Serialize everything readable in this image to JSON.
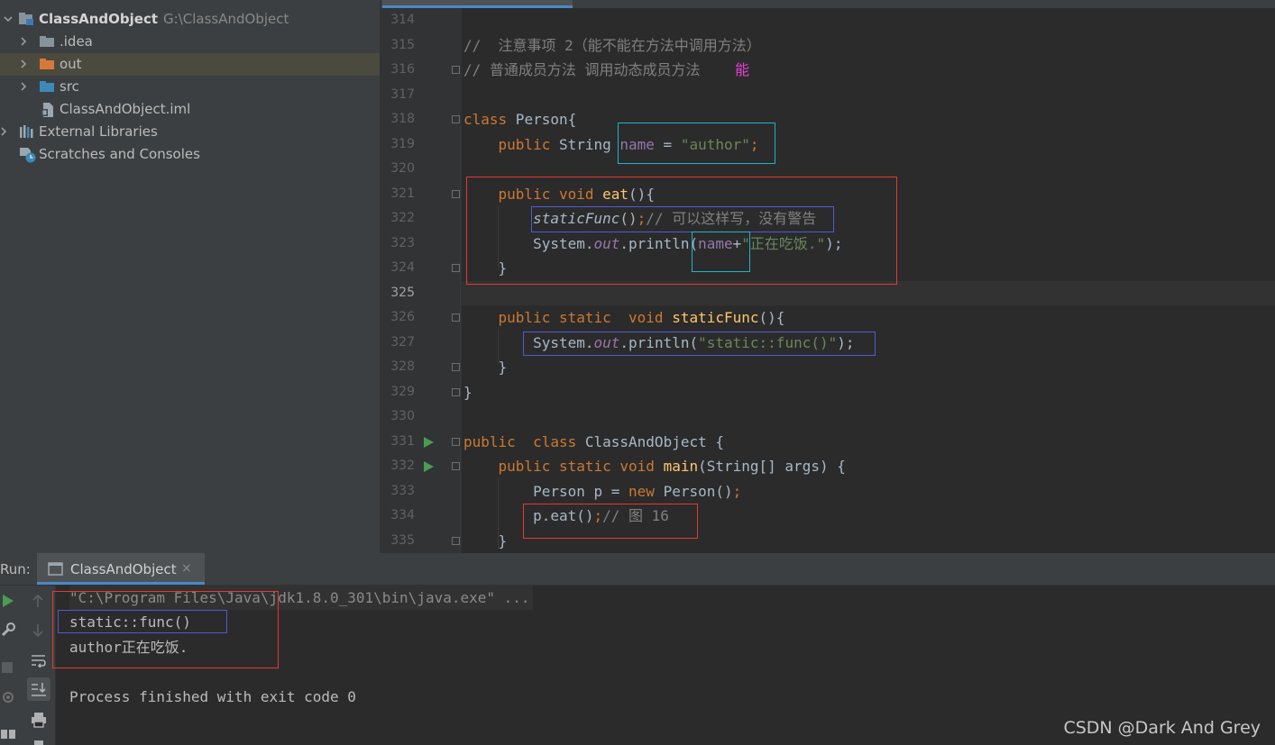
{
  "project": {
    "root_name": "ClassAndObject",
    "root_path": "G:\\ClassAndObject",
    "items": [
      {
        "label": ".idea"
      },
      {
        "label": "out"
      },
      {
        "label": "src"
      },
      {
        "label": "ClassAndObject.iml"
      },
      {
        "label": "External Libraries"
      },
      {
        "label": "Scratches and Consoles"
      }
    ]
  },
  "editor": {
    "line_numbers": [
      "314",
      "315",
      "316",
      "317",
      "318",
      "319",
      "320",
      "321",
      "322",
      "323",
      "324",
      "325",
      "326",
      "327",
      "328",
      "329",
      "330",
      "331",
      "332",
      "333",
      "334",
      "335"
    ],
    "code": {
      "l315": "//  注意事项 2（能不能在方法中调用方法）",
      "l316": "// 普通成员方法 调用动态成员方法",
      "l316_mark": "能",
      "l318_kw": "class",
      "l318_rest": " Person{",
      "l319_kw": "public",
      "l319_type": " String ",
      "l319_field": "name",
      "l319_eq": " = ",
      "l319_str": "\"author\"",
      "l319_semi": ";",
      "l321_kw": "public void",
      "l321_fn": "eat",
      "l321_rest": "(){",
      "l322_call": "staticFunc",
      "l322_paren": "()",
      "l322_semi": ";",
      "l322_cmt": "// 可以这样写，没有警告",
      "l323_sys": "System.",
      "l323_out": "out",
      "l323_println": ".println(",
      "l323_name": "name",
      "l323_plus": "+",
      "l323_str": "\"正在吃饭.\"",
      "l323_end": ");",
      "l324": "}",
      "l326_kw": "public static  void",
      "l326_fn": "staticFunc",
      "l326_rest": "(){",
      "l327_sys": "System.",
      "l327_out": "out",
      "l327_println": ".println(",
      "l327_str": "\"static::func()\"",
      "l327_end": ");",
      "l328": "}",
      "l329": "}",
      "l331_kw": "public  class",
      "l331_rest": " ClassAndObject {",
      "l332_kw": "public static void",
      "l332_fn": "main",
      "l332_rest": "(String[] args) {",
      "l333_a": "Person p = ",
      "l333_kw": "new",
      "l333_b": " Person()",
      "l333_semi": ";",
      "l334_a": "p.eat()",
      "l334_semi": ";",
      "l334_cmt": "// 图 16",
      "l335": "}"
    }
  },
  "run": {
    "label": "Run:",
    "tab_name": "ClassAndObject",
    "tab_close": "×",
    "console": [
      "\"C:\\Program Files\\Java\\jdk1.8.0_301\\bin\\java.exe\" ...",
      "static::func()",
      "author正在吃饭.",
      "",
      "Process finished with exit code 0"
    ]
  },
  "watermark": "CSDN @Dark And Grey",
  "colors": {
    "keyword": "#cc7832",
    "function": "#ffc66d",
    "field": "#9876aa",
    "string": "#6a8759",
    "comment": "#808080",
    "annotation_red": "#e53935",
    "annotation_blue": "#4f5bd5",
    "annotation_cyan": "#1fb3c9"
  }
}
